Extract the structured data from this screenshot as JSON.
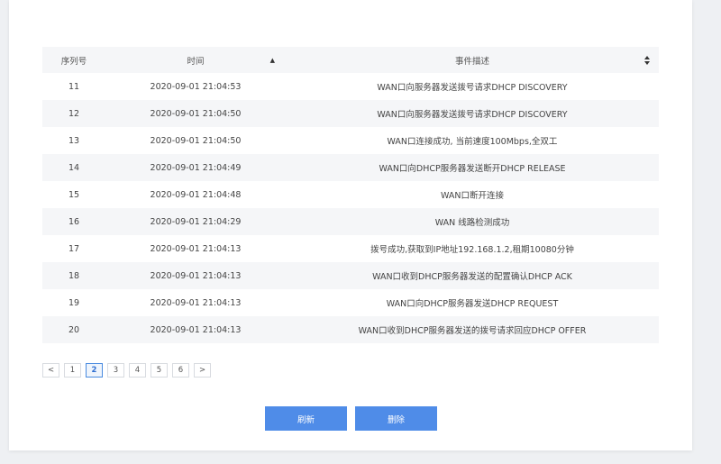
{
  "table": {
    "headers": {
      "seq": "序列号",
      "time": "时间",
      "desc": "事件描述"
    },
    "rows": [
      {
        "seq": "11",
        "time": "2020-09-01 21:04:53",
        "desc": "WAN口向服务器发送拨号请求DHCP DISCOVERY"
      },
      {
        "seq": "12",
        "time": "2020-09-01 21:04:50",
        "desc": "WAN口向服务器发送拨号请求DHCP DISCOVERY"
      },
      {
        "seq": "13",
        "time": "2020-09-01 21:04:50",
        "desc": "WAN口连接成功, 当前速度100Mbps,全双工"
      },
      {
        "seq": "14",
        "time": "2020-09-01 21:04:49",
        "desc": "WAN口向DHCP服务器发送断开DHCP RELEASE"
      },
      {
        "seq": "15",
        "time": "2020-09-01 21:04:48",
        "desc": "WAN口断开连接"
      },
      {
        "seq": "16",
        "time": "2020-09-01 21:04:29",
        "desc": "WAN 线路检测成功"
      },
      {
        "seq": "17",
        "time": "2020-09-01 21:04:13",
        "desc": "拨号成功,获取到IP地址192.168.1.2,租期10080分钟"
      },
      {
        "seq": "18",
        "time": "2020-09-01 21:04:13",
        "desc": "WAN口收到DHCP服务器发送的配置确认DHCP ACK"
      },
      {
        "seq": "19",
        "time": "2020-09-01 21:04:13",
        "desc": "WAN口向DHCP服务器发送DHCP REQUEST"
      },
      {
        "seq": "20",
        "time": "2020-09-01 21:04:13",
        "desc": "WAN口收到DHCP服务器发送的拨号请求回应DHCP OFFER"
      }
    ]
  },
  "pagination": {
    "prev": "<",
    "next": ">",
    "pages": [
      "1",
      "2",
      "3",
      "4",
      "5",
      "6"
    ],
    "current": "2"
  },
  "buttons": {
    "refresh": "刷新",
    "delete": "删除"
  },
  "colors": {
    "primary": "#4f8ce8",
    "stripe": "#f5f6f8"
  }
}
